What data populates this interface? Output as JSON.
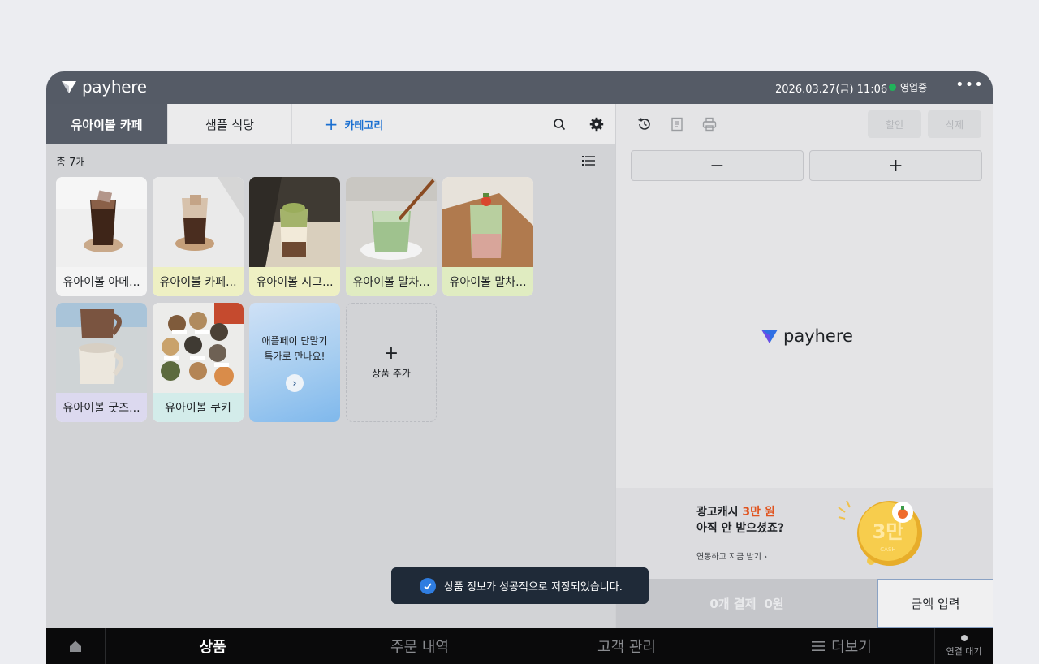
{
  "topbar": {
    "brand": "payhere",
    "datetime": "2026.03.27(금) 11:06",
    "status": "영업중",
    "status_color": "#20b35a",
    "more_icon": "•••"
  },
  "tabs": {
    "items": [
      {
        "label": "유아이볼 카페",
        "active": true
      },
      {
        "label": "샘플 식당",
        "active": false
      }
    ],
    "add_category": "카테고리"
  },
  "products": {
    "count_label": "총 7개",
    "items": [
      {
        "name": "유아이볼 아메...",
        "bg": "#f4f4f4"
      },
      {
        "name": "유아이볼 카페...",
        "bg": "#eef0c3"
      },
      {
        "name": "유아이볼 시그...",
        "bg": "#eef0c3"
      },
      {
        "name": "유아이볼 말차...",
        "bg": "#e0ecc1"
      },
      {
        "name": "유아이볼 말차...",
        "bg": "#e0ecc1"
      },
      {
        "name": "유아이볼 굿즈...",
        "bg": "#dcd9ef"
      },
      {
        "name": "유아이볼 쿠키",
        "bg": "#d3ecea"
      }
    ],
    "promo": {
      "line1": "애플페이 단말기",
      "line2": "특가로 만나요!"
    },
    "add_label": "상품 추가"
  },
  "toast": {
    "message": "상품 정보가 성공적으로 저장되었습니다."
  },
  "order": {
    "discount_label": "할인",
    "delete_label": "삭제",
    "minus": "−",
    "plus": "+",
    "brand": "payhere"
  },
  "ad": {
    "line1_prefix": "광고캐시 ",
    "line1_emphasis": "3만 원",
    "line2": "아직 안 받으셨죠?",
    "link": "연동하고 지금 받기 ›",
    "coin_text": "3만",
    "coin_sub": "CASH"
  },
  "payment": {
    "count": "0개 결제",
    "amount": "0원",
    "amount_input": "금액 입력"
  },
  "bottom_nav": {
    "items": [
      "상품",
      "주문 내역",
      "고객 관리",
      "더보기"
    ],
    "connection": "연결 대기"
  }
}
